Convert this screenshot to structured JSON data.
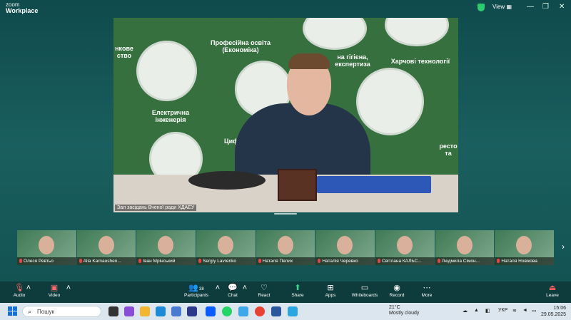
{
  "app": {
    "brand_top": "zoom",
    "brand_bottom": "Workplace",
    "view_label": "View"
  },
  "stage": {
    "wall_texts": [
      "Професійна освіта (Економіка)",
      "Електрична інженерія",
      "Харчові технології",
      "на гігієна, експертиза",
      "нкове ство",
      "Циф",
      "ресто та"
    ],
    "label": "Зал засідань Вченої ради ХДАЕУ"
  },
  "participants": [
    {
      "name": "Олеся Ревтьо"
    },
    {
      "name": "Alla Karnaushen..."
    },
    {
      "name": "Іван Мрінський"
    },
    {
      "name": "Sergiy Lavrenko"
    },
    {
      "name": "Наталя Пелих"
    },
    {
      "name": "Наталія Черевко"
    },
    {
      "name": "Світлана КАЛЬС..."
    },
    {
      "name": "Людмила Сімон..."
    },
    {
      "name": "Наталя Новікова"
    }
  ],
  "toolbar": {
    "audio": "Audio",
    "video": "Video",
    "participants": "Participants",
    "participants_count": "38",
    "chat": "Chat",
    "react": "React",
    "share": "Share",
    "apps": "Apps",
    "whiteboards": "Whiteboards",
    "record": "Record",
    "more": "More",
    "leave": "Leave"
  },
  "taskbar": {
    "search_placeholder": "Пошук",
    "weather_temp": "21°C",
    "weather_desc": "Mostly cloudy",
    "lang": "УКР",
    "time": "15:06",
    "date": "29.05.2025"
  },
  "colors": {
    "accent_share": "#3dd68c",
    "leave": "#ff5c5c",
    "muted_mic": "#e64545",
    "toolbar_bg": "#0e3c3c"
  }
}
